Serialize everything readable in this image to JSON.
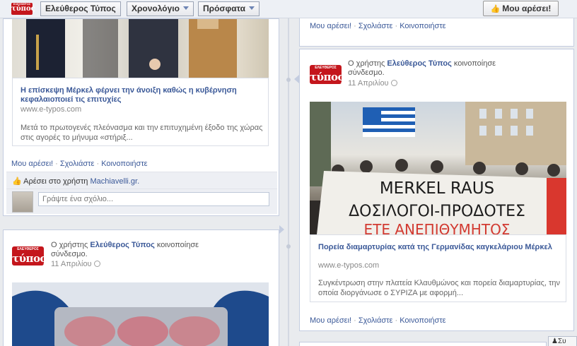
{
  "topbar": {
    "logo_small": "ΕΛΕΥΘΕΡΟΣ",
    "logo": "τύπος",
    "page_name": "Ελεύθερος Τύπος",
    "timeline_menu": "Χρονολόγιο",
    "recent_menu": "Πρόσφατα",
    "like_button": "Μου αρέσει!"
  },
  "actions": {
    "like": "Μου αρέσει!",
    "comment": "Σχολιάστε",
    "share": "Κοινοποιήστε",
    "sep": "·"
  },
  "post1": {
    "link_title": "Η επίσκεψη Μέρκελ φέρνει την άνοιξη καθώς η κυβέρνηση κεφαλαιοποιεί τις επιτυχίες",
    "link_url": "www.e-typos.com",
    "link_desc": "Μετά το πρωτογενές πλεόνασμα και την επιτυχημένη έξοδο της χώρας στις αγορές το μήνυμα «στήριξ...",
    "likes_prefix": "Αρέσει στο χρήστη",
    "likes_user": "Machiavelli.gr.",
    "comment_placeholder": "Γράψτε ένα σχόλιο..."
  },
  "post2": {
    "user_prefix": "Ο χρήστης",
    "user_name": "Ελεύθερος Τύπος",
    "user_suffix": "κοινοποίησε",
    "user_line2": "σύνδεσμο.",
    "date": "11 Απριλίου",
    "banner_line1": "MERKEL RAUS",
    "banner_line2": "ΔΟΣΙΛΟΓΟΙ-ΠΡΟΔΟΤΕΣ",
    "banner_line3": "ΕΤΕ ΑΝΕΠΙΘΥΜΗΤΟΣ",
    "link_title": "Πορεία διαμαρτυρίας κατά της Γερμανίδας καγκελάριου Μέρκελ",
    "link_url": "www.e-typos.com",
    "link_desc": "Συγκέντρωση στην πλατεία Κλαυθμώνος και πορεία διαμαρτυρίας, την οποία διοργάνωσε ο ΣΥΡΙΖΑ με αφορμή..."
  },
  "post3": {
    "user_prefix": "Ο χρήστης",
    "user_name": "Ελεύθερος Τύπος",
    "user_suffix": "κοινοποίησε",
    "user_line2": "σύνδεσμο.",
    "date": "11 Απριλίου"
  },
  "chat_tab": "Συ"
}
